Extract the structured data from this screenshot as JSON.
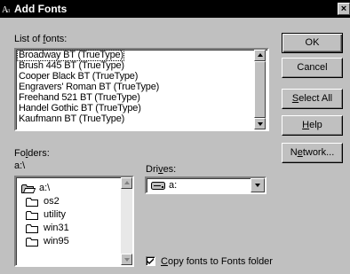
{
  "window": {
    "title": "Add Fonts",
    "close_glyph": "×"
  },
  "fonts": {
    "label_pre": "List of ",
    "label_key": "f",
    "label_post": "onts:",
    "items": [
      "Broadway BT (TrueType)",
      "Brush 445 BT (TrueType)",
      "Cooper Black BT (TrueType)",
      "Engravers' Roman BT (TrueType)",
      "Freehand 521 BT (TrueType)",
      "Handel Gothic BT (TrueType)",
      "Kaufmann BT (TrueType)"
    ]
  },
  "buttons": {
    "ok": "OK",
    "cancel": "Cancel",
    "select_all_key": "S",
    "select_all_rest": "elect All",
    "help_key": "H",
    "help_rest": "elp",
    "network_pre": "N",
    "network_key": "e",
    "network_post": "twork..."
  },
  "folders": {
    "label_pre": "Fo",
    "label_key": "l",
    "label_post": "ders:",
    "current_path": "a:\\",
    "items": [
      {
        "name": "a:\\",
        "icon": "open-folder-icon"
      },
      {
        "name": "os2",
        "icon": "folder-icon"
      },
      {
        "name": "utility",
        "icon": "folder-icon"
      },
      {
        "name": "win31",
        "icon": "folder-icon"
      },
      {
        "name": "win95",
        "icon": "folder-icon"
      }
    ]
  },
  "drives": {
    "label_pre": "Dri",
    "label_key": "v",
    "label_post": "es:",
    "selected": "a:",
    "icon": "floppy-drive-icon"
  },
  "copy_option": {
    "key": "C",
    "rest": "opy fonts to Fonts folder",
    "checked": true
  }
}
